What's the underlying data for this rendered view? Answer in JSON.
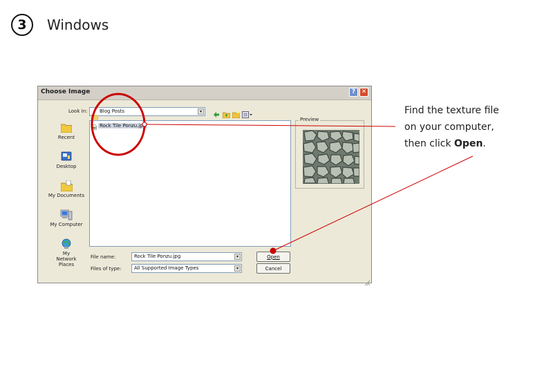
{
  "step": {
    "number": "3",
    "title": "Windows"
  },
  "dialog": {
    "title": "Choose Image",
    "help_glyph": "?",
    "close_glyph": "✕",
    "look_in_label": "Look in:",
    "look_in_value": "Blog Posts",
    "places": [
      "Recent",
      "Desktop",
      "My Documents",
      "My Computer",
      "My Network Places"
    ],
    "files": [
      "Rock Tile Ponzu.jpg"
    ],
    "preview_label": "Preview",
    "file_name_label": "File name:",
    "file_name_value": "Rock Tile Ponzu.jpg",
    "file_type_label": "Files of type:",
    "file_type_value": "All Supported Image Types",
    "open_button": "Open",
    "cancel_button": "Cancel"
  },
  "annotation": {
    "line1": "Find the texture file",
    "line2": "on your computer,",
    "line3_prefix": "then click ",
    "line3_bold": "Open",
    "line3_suffix": "."
  },
  "colors": {
    "annotation_red": "#cc0000",
    "dialog_face": "#ece9d8",
    "close_red": "#d44b2c"
  }
}
